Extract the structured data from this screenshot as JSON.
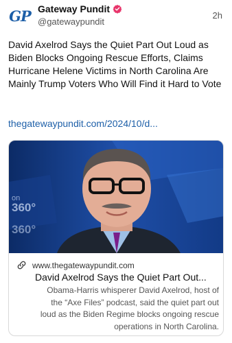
{
  "post": {
    "avatar_text": "GP",
    "display_name": "Gateway Pundit",
    "handle": "@gatewaypundit",
    "time": "2h",
    "text": "David Axelrod Says the Quiet Part Out Loud as Biden Blocks Ongoing Rescue Efforts, Claims Hurricane Helene Victims in North Carolina Are Mainly Trump Voters Who Will Find it Hard to Vote",
    "link": "thegatewaypundit.com/2024/10/d..."
  },
  "card": {
    "image_overlay": "360°",
    "image_overlay_2": "360°",
    "image_overlay_3": "on",
    "domain": "www.thegatewaypundit.com",
    "title": "David Axelrod Says the Quiet Part Out...",
    "description": "Obama-Harris whisperer David Axelrod, host of the “Axe Files” podcast, said the quiet part out loud as the Biden Regime blocks ongoing rescue operations in North Carolina."
  },
  "icons": {
    "verified": "verified-badge-icon",
    "link": "link-icon"
  },
  "colors": {
    "brand_blue": "#1d5fa8",
    "verified_pink": "#e8356b",
    "image_background": "#1b3f86"
  }
}
